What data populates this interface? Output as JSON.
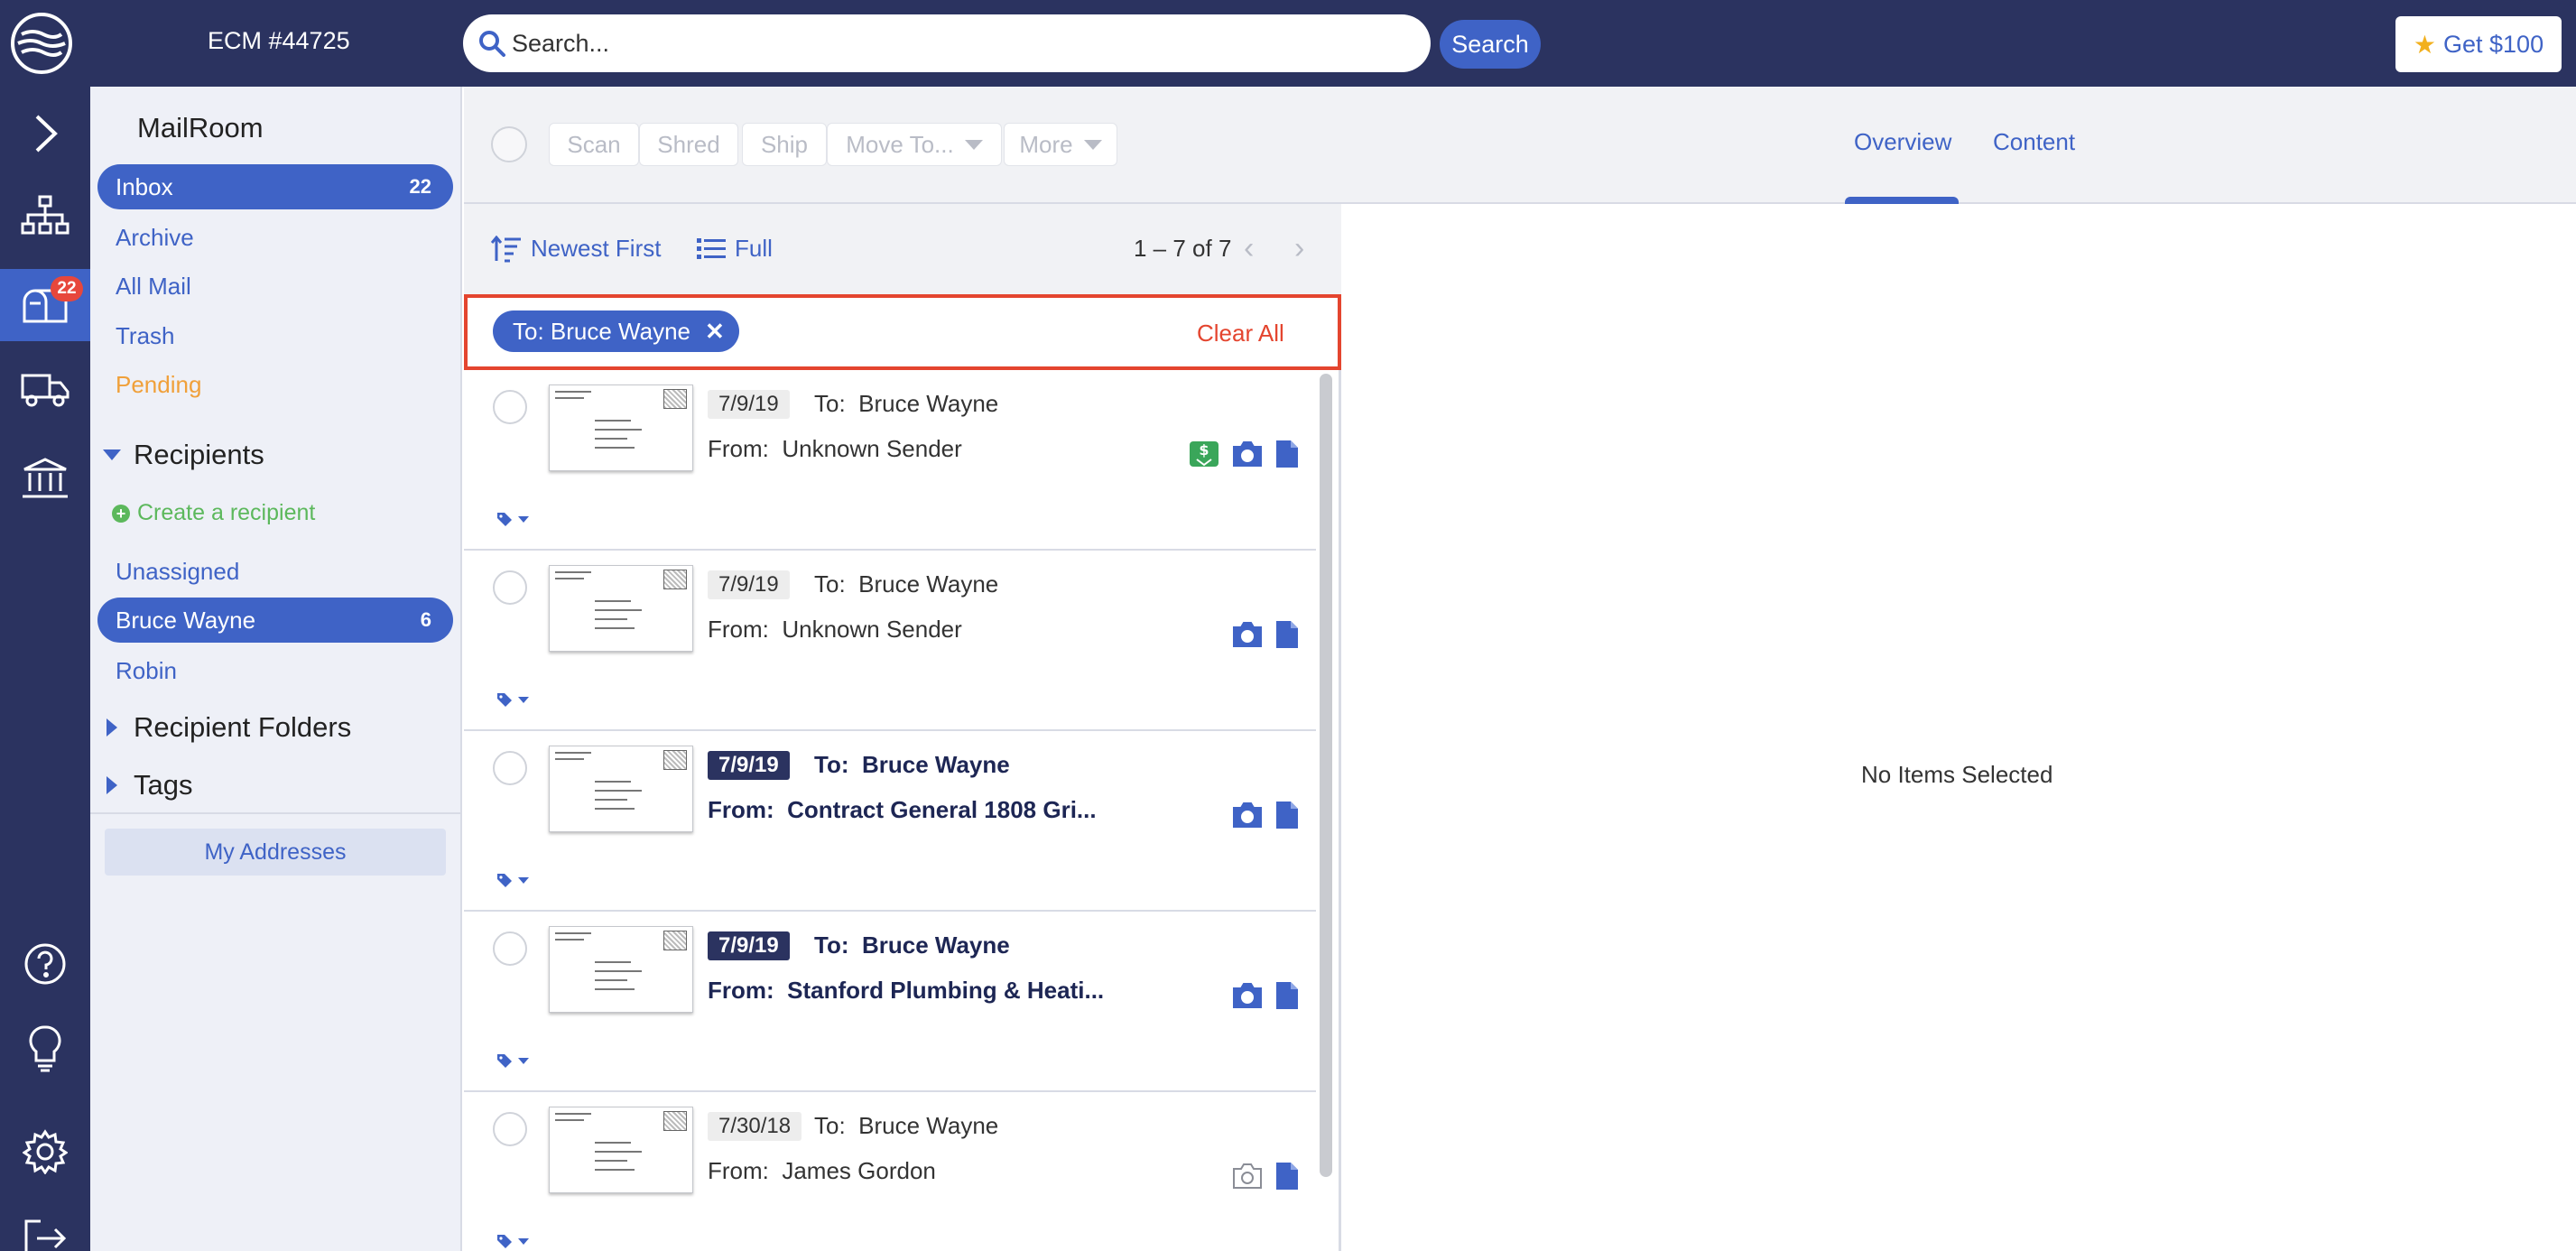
{
  "header": {
    "account": "ECM #44725",
    "search_placeholder": "Search...",
    "search_button": "Search",
    "promo_button": "Get $100",
    "promo_icon": "star-icon"
  },
  "rail": {
    "items": [
      {
        "name": "expand-icon",
        "badge": ""
      },
      {
        "name": "org-chart-icon",
        "badge": ""
      },
      {
        "name": "mailbox-icon",
        "badge": "22"
      },
      {
        "name": "truck-icon",
        "badge": ""
      },
      {
        "name": "bank-icon",
        "badge": ""
      },
      {
        "name": "help-icon",
        "badge": ""
      },
      {
        "name": "lightbulb-icon",
        "badge": ""
      },
      {
        "name": "gear-icon",
        "badge": ""
      },
      {
        "name": "logout-icon",
        "badge": ""
      }
    ]
  },
  "sidebar": {
    "title": "MailRoom",
    "inbox": {
      "label": "Inbox",
      "count": "22"
    },
    "archive": "Archive",
    "all_mail": "All Mail",
    "trash": "Trash",
    "pending": "Pending",
    "recipients_heading": "Recipients",
    "create_recipient": "Create a recipient",
    "unassigned": "Unassigned",
    "selected_recipient": {
      "label": "Bruce Wayne",
      "count": "6"
    },
    "robin": "Robin",
    "recipient_folders": "Recipient Folders",
    "tags": "Tags",
    "my_addresses": "My Addresses"
  },
  "toolbar": {
    "scan": "Scan",
    "shred": "Shred",
    "ship": "Ship",
    "move_to": "Move To...",
    "more": "More",
    "tab_overview": "Overview",
    "tab_content": "Content"
  },
  "list": {
    "sort": "Newest First",
    "view": "Full",
    "pager": "1 – 7 of 7",
    "filter_chip": "To: Bruce Wayne",
    "clear_all": "Clear All",
    "to_prefix": "To:",
    "from_prefix": "From:",
    "items": [
      {
        "date": "7/9/19",
        "to": "Bruce Wayne",
        "from": "Unknown Sender",
        "unread": false,
        "check_deposit": true,
        "camera_color": "#3f63c6"
      },
      {
        "date": "7/9/19",
        "to": "Bruce Wayne",
        "from": "Unknown Sender",
        "unread": false,
        "check_deposit": false,
        "camera_color": "#3f63c6"
      },
      {
        "date": "7/9/19",
        "to": "Bruce Wayne",
        "from": "Contract General 1808 Gri...",
        "unread": true,
        "check_deposit": false,
        "camera_color": "#3f63c6"
      },
      {
        "date": "7/9/19",
        "to": "Bruce Wayne",
        "from": "Stanford Plumbing & Heati...",
        "unread": true,
        "check_deposit": false,
        "camera_color": "#3f63c6"
      },
      {
        "date": "7/30/18",
        "to": "Bruce Wayne",
        "from": "James Gordon",
        "unread": false,
        "check_deposit": false,
        "camera_color": "#8a8d96"
      }
    ]
  },
  "detail": {
    "empty_text": "No Items Selected"
  }
}
